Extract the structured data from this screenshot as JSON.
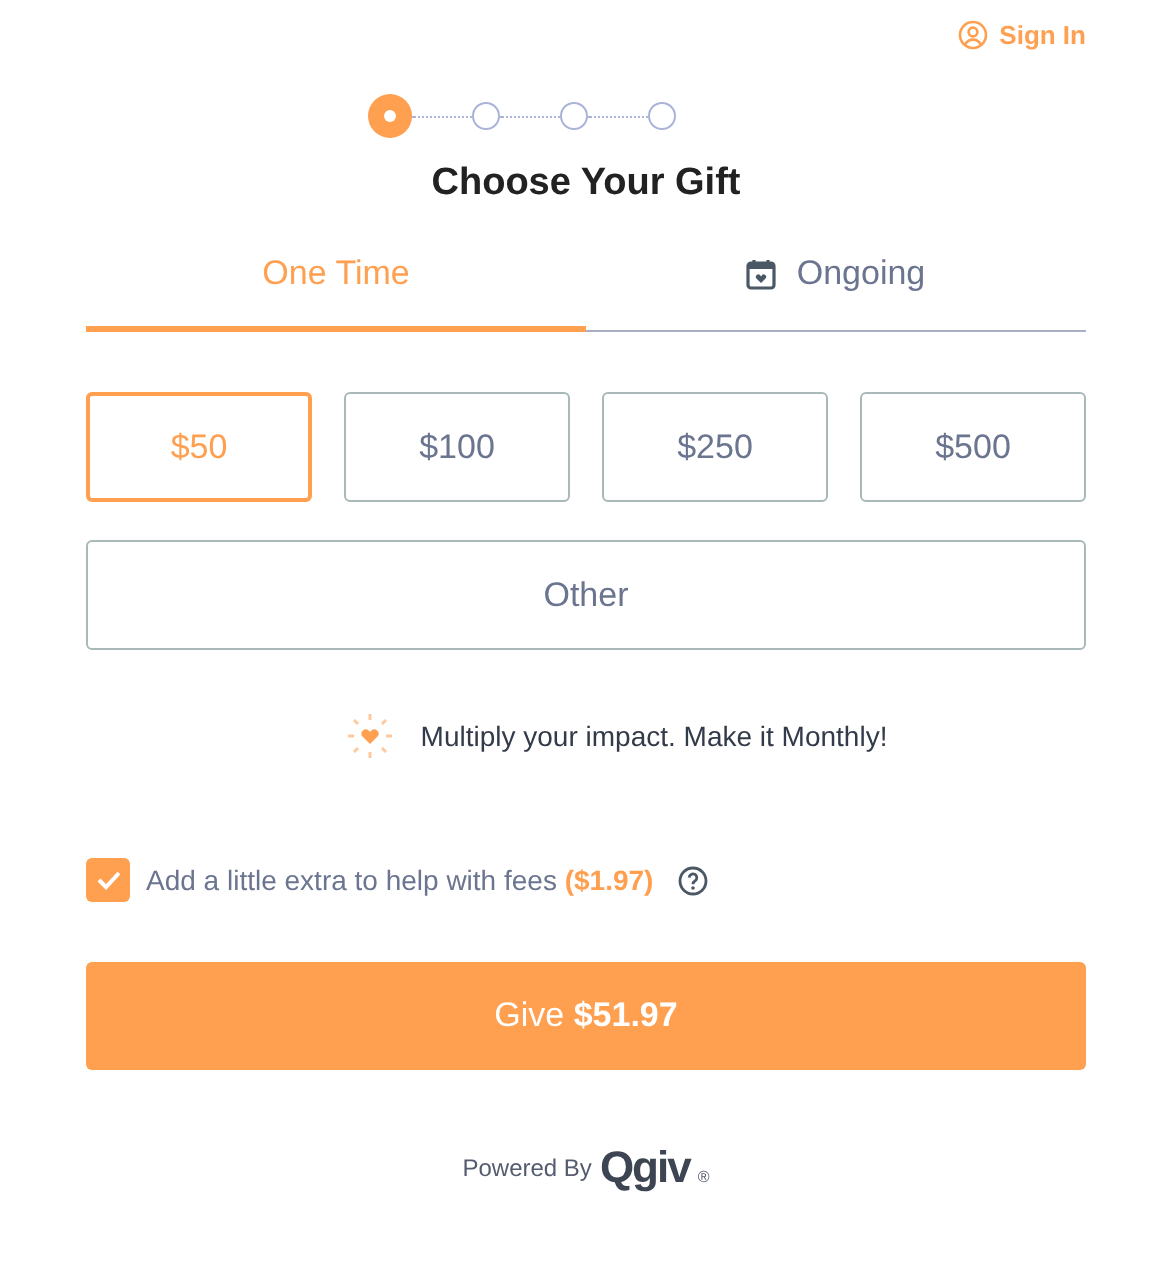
{
  "header": {
    "sign_in": "Sign In"
  },
  "steps": [
    {
      "selected": true
    },
    {
      "selected": false
    },
    {
      "selected": false
    },
    {
      "selected": false
    }
  ],
  "title": "Choose Your Gift",
  "tabs": [
    {
      "label": "One Time",
      "selected": true,
      "kind": "plain"
    },
    {
      "label": "Ongoing",
      "selected": false,
      "kind": "scheduled"
    }
  ],
  "amounts": [
    {
      "label": "$50",
      "selected": true
    },
    {
      "label": "$100",
      "selected": false
    },
    {
      "label": "$250",
      "selected": false
    },
    {
      "label": "$500",
      "selected": false
    }
  ],
  "other": {
    "label": "Other",
    "selected": false
  },
  "promo": "Multiply your impact. Make it Monthly!",
  "fees": {
    "label": "Add a little extra to help with fees **($1.97)**",
    "checked": true
  },
  "give_button": "Give **$51.97**",
  "footer": {
    "powered_by": "Powered By",
    "logo": "Qgiv",
    "registered": "®"
  }
}
